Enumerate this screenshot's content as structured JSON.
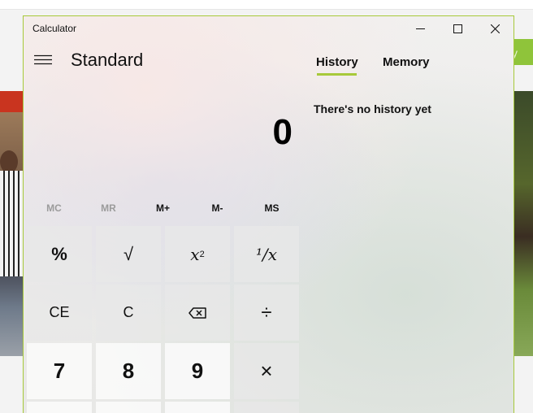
{
  "background": {
    "right_banner_text": "y"
  },
  "window": {
    "title": "Calculator",
    "accent_color": "#a7c93a"
  },
  "header": {
    "mode": "Standard"
  },
  "display": {
    "value": "0"
  },
  "memory_buttons": [
    {
      "label": "MC",
      "enabled": false
    },
    {
      "label": "MR",
      "enabled": false
    },
    {
      "label": "M+",
      "enabled": true
    },
    {
      "label": "M-",
      "enabled": true
    },
    {
      "label": "MS",
      "enabled": true
    }
  ],
  "keys": {
    "percent": "%",
    "sqrt": "√",
    "square_base": "x",
    "square_exp": "2",
    "reciprocal": "¹/x",
    "ce": "CE",
    "clear": "C",
    "backspace_icon": "backspace-icon",
    "divide": "÷",
    "seven": "7",
    "eight": "8",
    "nine": "9",
    "multiply": "×"
  },
  "history_pane": {
    "tabs": [
      {
        "label": "History",
        "selected": true
      },
      {
        "label": "Memory",
        "selected": false
      }
    ],
    "empty_message": "There's no history yet"
  }
}
